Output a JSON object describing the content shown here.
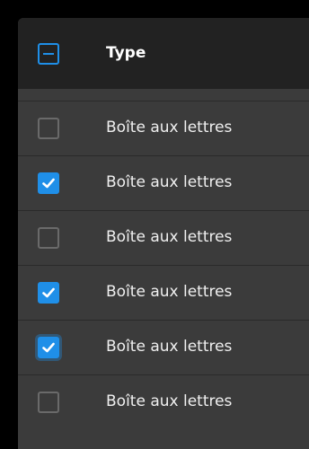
{
  "table": {
    "header": {
      "label": "Type",
      "select_all_state": "indeterminate"
    },
    "rows": [
      {
        "label": "Boîte aux lettres",
        "checked": false
      },
      {
        "label": "Boîte aux lettres",
        "checked": true
      },
      {
        "label": "Boîte aux lettres",
        "checked": false
      },
      {
        "label": "Boîte aux lettres",
        "checked": true
      },
      {
        "label": "Boîte aux lettres",
        "checked": true,
        "focused": true
      },
      {
        "label": "Boîte aux lettres",
        "checked": false
      }
    ]
  },
  "colors": {
    "accent": "#1f8fe8",
    "header_bg": "#222222",
    "row_bg": "#3b3b3b",
    "page_bg": "#000000"
  }
}
